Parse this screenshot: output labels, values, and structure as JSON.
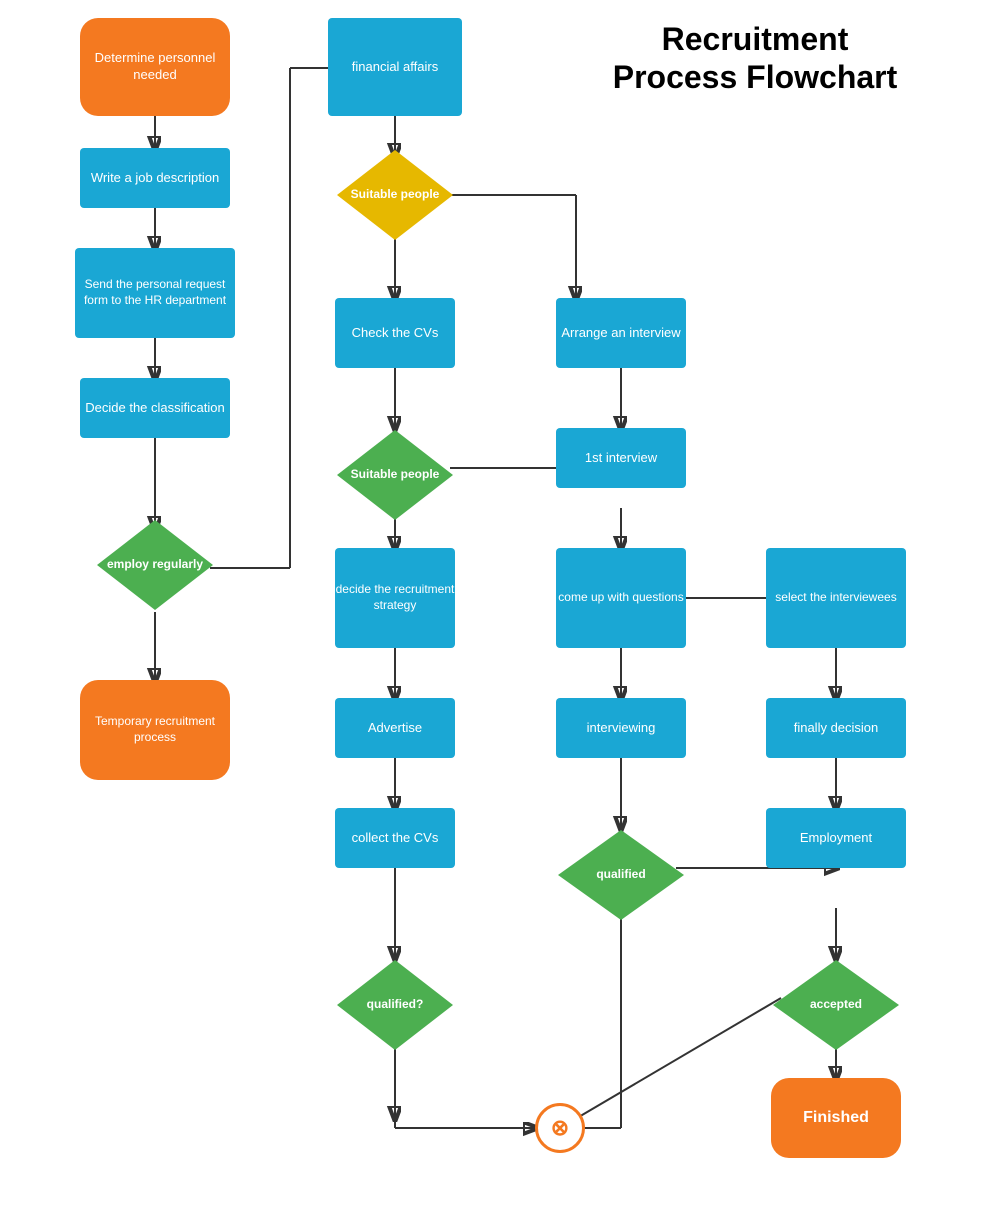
{
  "title": "Recruitment\nProcess Flowchart",
  "nodes": {
    "determine": "Determine personnel needed",
    "write_job": "Write a job description",
    "send_personal": "Send the personal request form to the HR department",
    "decide_class": "Decide the classification",
    "employ_diamond": "employ regularly",
    "temp_recruit": "Temporary recruitment process",
    "financial": "financial affairs",
    "suitable1_diamond": "Suitable people",
    "check_cvs": "Check the CVs",
    "suitable2_diamond": "Suitable people",
    "decide_recruit": "decide the recruitment strategy",
    "advertise": "Advertise",
    "collect_cvs": "collect the CVs",
    "qualified1_diamond": "qualified?",
    "arrange_interview": "Arrange an interview",
    "first_interview": "1st interview",
    "come_up": "come up with questions",
    "interviewing": "interviewing",
    "qualified2_diamond": "qualified",
    "select_interviewees": "select the interviewees",
    "finally_decision": "finally decision",
    "employment": "Employment",
    "accepted_diamond": "accepted",
    "finished": "Finished",
    "circle_x": "⊗"
  }
}
